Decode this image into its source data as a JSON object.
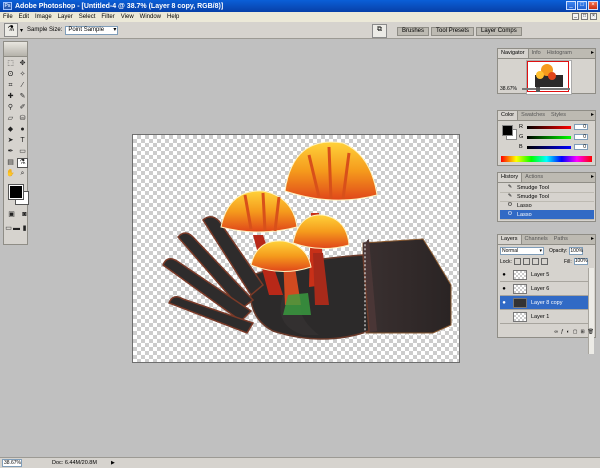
{
  "window": {
    "title": "Adobe Photoshop - [Untitled-4 @ 38.7% (Layer 8 copy, RGB/8)]",
    "app_logo": "Ps"
  },
  "window_controls": [
    "_",
    "□",
    "×"
  ],
  "menu": [
    "File",
    "Edit",
    "Image",
    "Layer",
    "Select",
    "Filter",
    "View",
    "Window",
    "Help"
  ],
  "doc_controls": [
    "_",
    "□",
    "×"
  ],
  "options": {
    "tool_icon": "eyedropper-icon",
    "sample_size_label": "Sample Size:",
    "sample_size_value": "Point Sample"
  },
  "palette_well": [
    "Brushes",
    "Tool Presets",
    "Layer Comps"
  ],
  "toolbox": {
    "tools": [
      {
        "name": "marquee-icon",
        "glyph": "⬚"
      },
      {
        "name": "move-icon",
        "glyph": "✥"
      },
      {
        "name": "lasso-icon",
        "glyph": "ʘ"
      },
      {
        "name": "magic-wand-icon",
        "glyph": "✧"
      },
      {
        "name": "crop-icon",
        "glyph": "⌗"
      },
      {
        "name": "slice-icon",
        "glyph": "⁄"
      },
      {
        "name": "healing-brush-icon",
        "glyph": "✚"
      },
      {
        "name": "brush-icon",
        "glyph": "✎"
      },
      {
        "name": "clone-stamp-icon",
        "glyph": "⚲"
      },
      {
        "name": "history-brush-icon",
        "glyph": "✐"
      },
      {
        "name": "eraser-icon",
        "glyph": "▱"
      },
      {
        "name": "bucket-icon",
        "glyph": "⛁"
      },
      {
        "name": "blur-icon",
        "glyph": "◆"
      },
      {
        "name": "dodge-icon",
        "glyph": "●"
      },
      {
        "name": "path-select-icon",
        "glyph": "➤"
      },
      {
        "name": "type-icon",
        "glyph": "T"
      },
      {
        "name": "pen-icon",
        "glyph": "✒"
      },
      {
        "name": "shape-icon",
        "glyph": "▭"
      },
      {
        "name": "notes-icon",
        "glyph": "▤"
      },
      {
        "name": "eyedropper-icon",
        "glyph": "⚗"
      },
      {
        "name": "hand-icon",
        "glyph": "✋"
      },
      {
        "name": "zoom-icon",
        "glyph": "⌕"
      }
    ],
    "mode_icons": [
      "▣",
      "◙"
    ],
    "screen_icons": [
      "▭",
      "▬",
      "▮"
    ]
  },
  "status": {
    "zoom": "38.67%",
    "doc": "Doc: 6.44M/20.8M",
    "arrow": "▶"
  },
  "navigator": {
    "tabs": [
      "Navigator",
      "Info",
      "Histogram"
    ],
    "zoom": "38.67%"
  },
  "color_panel": {
    "tabs": [
      "Color",
      "Swatches",
      "Styles"
    ],
    "channels": [
      {
        "ch": "R",
        "val": "0",
        "bar": "#d03030"
      },
      {
        "ch": "G",
        "val": "0",
        "bar": "#30a030"
      },
      {
        "ch": "B",
        "val": "0",
        "bar": "#3030d0"
      }
    ]
  },
  "history": {
    "tabs": [
      "History",
      "Actions"
    ],
    "items": [
      {
        "label": "Smudge Tool",
        "icon": "✎",
        "selected": false
      },
      {
        "label": "Smudge Tool",
        "icon": "✎",
        "selected": false
      },
      {
        "label": "Lasso",
        "icon": "ʘ",
        "selected": false
      },
      {
        "label": "Lasso",
        "icon": "ʘ",
        "selected": true
      }
    ]
  },
  "layers": {
    "tabs": [
      "Layers",
      "Channels",
      "Paths"
    ],
    "blend": "Normal",
    "opacity_label": "Opacity:",
    "opacity": "100%",
    "lock_label": "Lock:",
    "fill_label": "Fill:",
    "fill": "100%",
    "items": [
      {
        "label": "Layer 5",
        "visible": true,
        "selected": false
      },
      {
        "label": "Layer 6",
        "visible": true,
        "selected": false
      },
      {
        "label": "Layer 8 copy",
        "visible": true,
        "selected": true
      },
      {
        "label": "Layer 1",
        "visible": false,
        "selected": false
      }
    ],
    "footer_icons": [
      "∞",
      "ƒ",
      "◐",
      "▢",
      "⊞",
      "🗑"
    ]
  }
}
